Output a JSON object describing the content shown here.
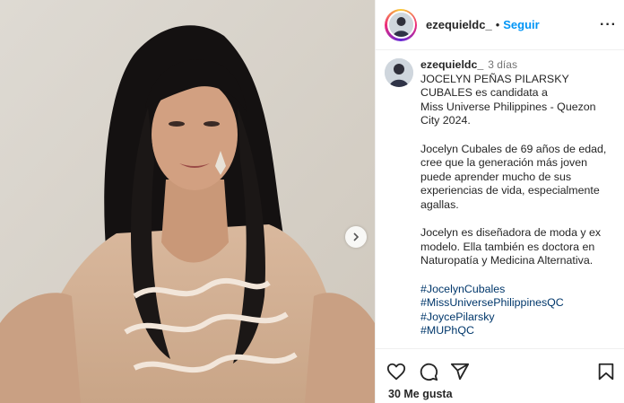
{
  "header": {
    "username": "ezequieldc_",
    "dot": "•",
    "follow_label": "Seguir",
    "more_label": "···"
  },
  "caption": {
    "username": "ezequieldc_",
    "time": "3 días",
    "lines": [
      "JOCELYN PEÑAS PILARSKY CUBALES es candidata a",
      "Miss Universe Philippines - Quezon City 2024.",
      "",
      "Jocelyn Cubales de 69 años de edad, cree que la generación más joven puede aprender mucho de sus experiencias de vida, especialmente agallas.",
      "",
      "Jocelyn es diseñadora de moda y ex modelo. Ella también es doctora en Naturopatía y Medicina Alternativa.",
      ""
    ],
    "hashtags": [
      "#JocelynCubales",
      "#MissUniversePhilippinesQC",
      "#JoycePilarsky",
      "#MUPhQC"
    ]
  },
  "actions": {
    "likes_label": "30 Me gusta"
  },
  "icons": {
    "like": "heart-icon",
    "comment": "comment-icon",
    "share": "share-icon",
    "save": "bookmark-icon",
    "next": "chevron-right-icon"
  },
  "colors": {
    "follow": "#0095f6",
    "hashtag": "#00376b",
    "text": "#262626",
    "muted": "#737373"
  }
}
